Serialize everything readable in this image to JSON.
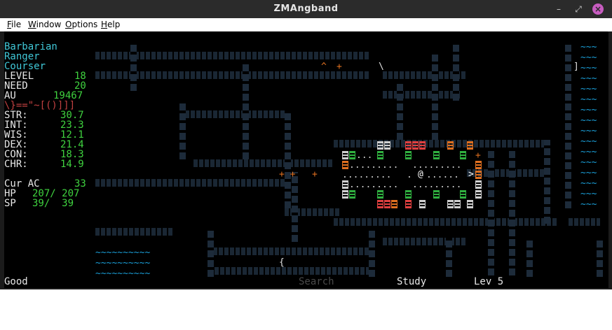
{
  "window": {
    "title": "ZMAngband",
    "min_symbol": "–",
    "max_symbol": "⤢",
    "close_symbol": "×"
  },
  "menu": {
    "file": "File",
    "window": "Window",
    "options": "Options",
    "help": "Help"
  },
  "character": {
    "race": "Barbarian",
    "class": "Ranger",
    "title": "Courser",
    "level_label": "LEVEL",
    "level": "18",
    "need_label": "NEED",
    "need": "20",
    "au_label": "AU",
    "au": "19467",
    "equipment": "\\}==\"~[()]]]",
    "str_label": "STR:",
    "str": "30.7",
    "int_label": "INT:",
    "int": "23.3",
    "wis_label": "WIS:",
    "wis": "12.1",
    "dex_label": "DEX:",
    "dex": "21.4",
    "con_label": "CON:",
    "con": "18.3",
    "chr_label": "CHR:",
    "chr": "14.9",
    "ac_label": "Cur AC",
    "ac": "33",
    "hp_label": "HP",
    "hp": "207/ 207",
    "sp_label": "SP",
    "sp": "39/  39"
  },
  "status": {
    "health": "Good",
    "search": "Search",
    "study": "Study",
    "depth": "Lev 5"
  },
  "map": {
    "player": "@",
    "stairs_down": ">",
    "floor_row": ".........",
    "water": "~~~~~~~~~~",
    "item_brace": "{",
    "item_bracket": "]",
    "trap": "^",
    "bolt": "\\"
  },
  "colors": {
    "text": "#40c8d8",
    "value": "#3fd23f",
    "label": "#e8e8e8",
    "wall": "#1d2b3a",
    "water": "#1a9fd8"
  }
}
